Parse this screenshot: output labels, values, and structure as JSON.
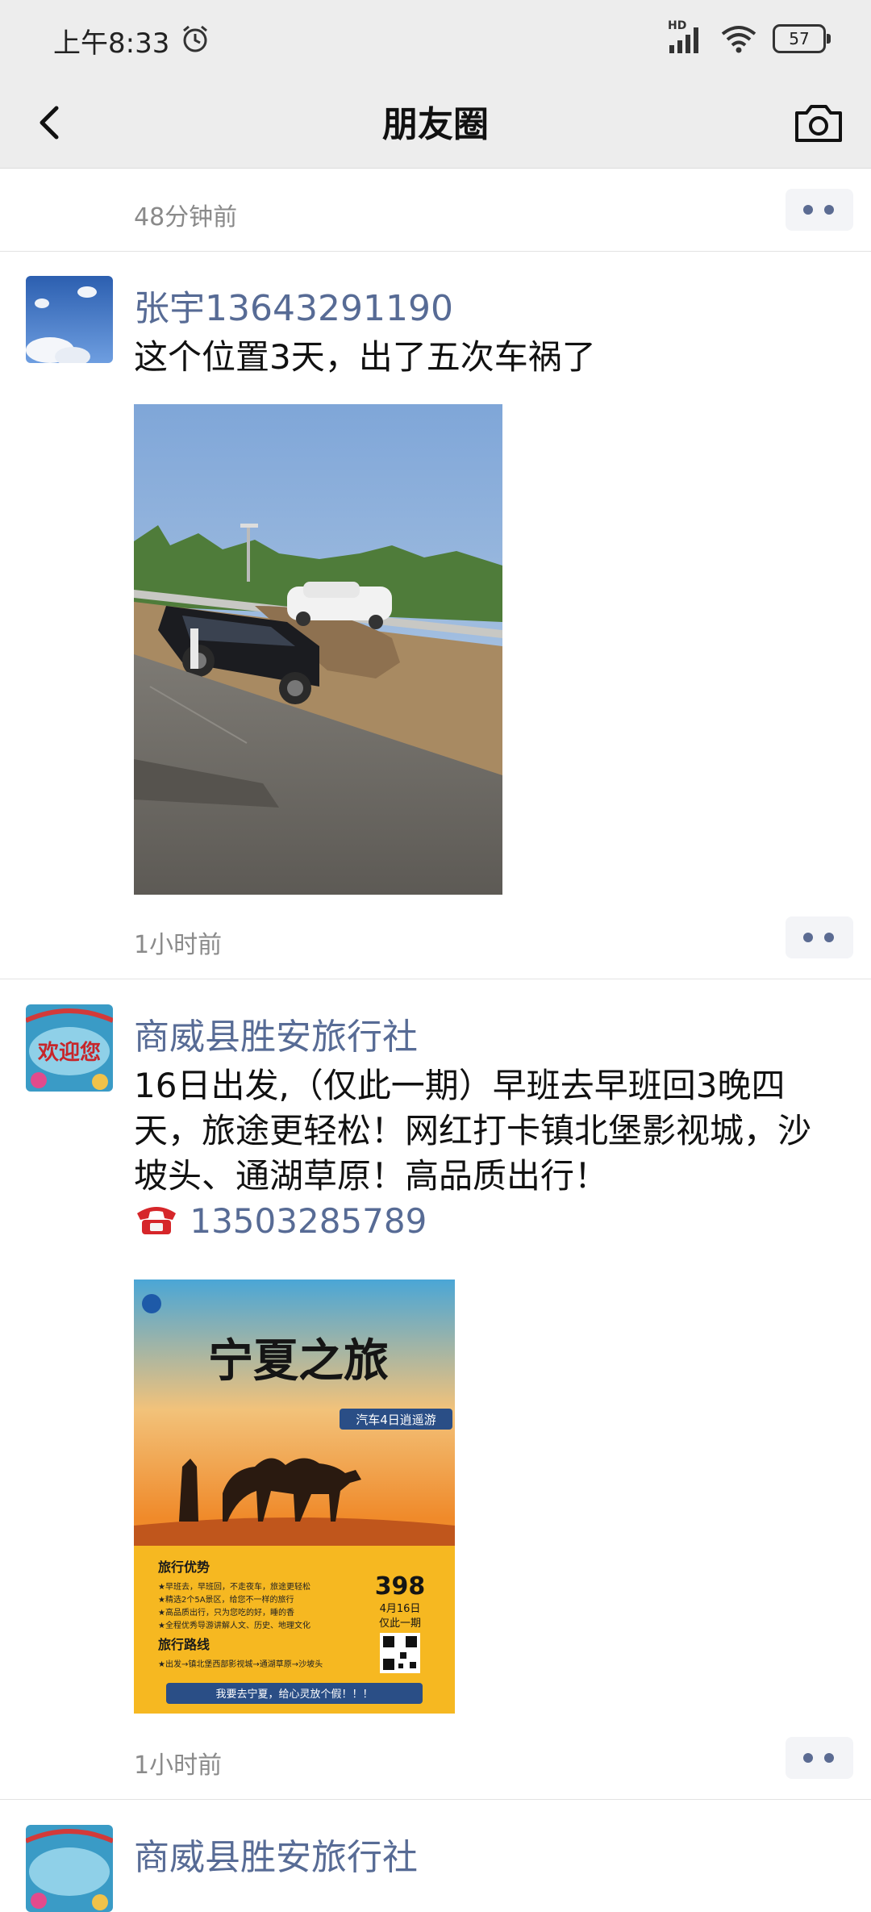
{
  "status": {
    "time": "上午8:33",
    "network": "HD",
    "battery": "57"
  },
  "nav": {
    "title": "朋友圈"
  },
  "posts": [
    {
      "time": "48分钟前"
    },
    {
      "name": "张宇13643291190",
      "text": "这个位置3天，出了五次车祸了",
      "time": "1小时前"
    },
    {
      "name": "商威县胜安旅行社",
      "text": "16日出发,（仅此一期）早班去早班回3晚四天，旅途更轻松！网红打卡镇北堡影视城，沙坡头、通湖草原！高品质出行！",
      "phone": "13503285789",
      "time": "1小时前",
      "avatar_text": "欢迎您",
      "poster": {
        "title": "宁夏之旅",
        "tag": "汽车4日逍遥游",
        "sec1": "旅行优势",
        "bullets": [
          "★早班去，早班回，不走夜车，旅途更轻松",
          "★精选2个5A景区，给您不一样的旅行",
          "★高品质出行，只为您吃的好，睡的香",
          "★全程优秀导游讲解人文、历史、地理文化"
        ],
        "sec2": "旅行路线",
        "route": "★出发→镇北堡西部影视城→通湖草原→沙坡头",
        "price": "398",
        "date": "4月16日",
        "once": "仅此一期",
        "slogan": "我要去宁夏，给心灵放个假！！！"
      }
    },
    {
      "name": "商威县胜安旅行社"
    }
  ]
}
